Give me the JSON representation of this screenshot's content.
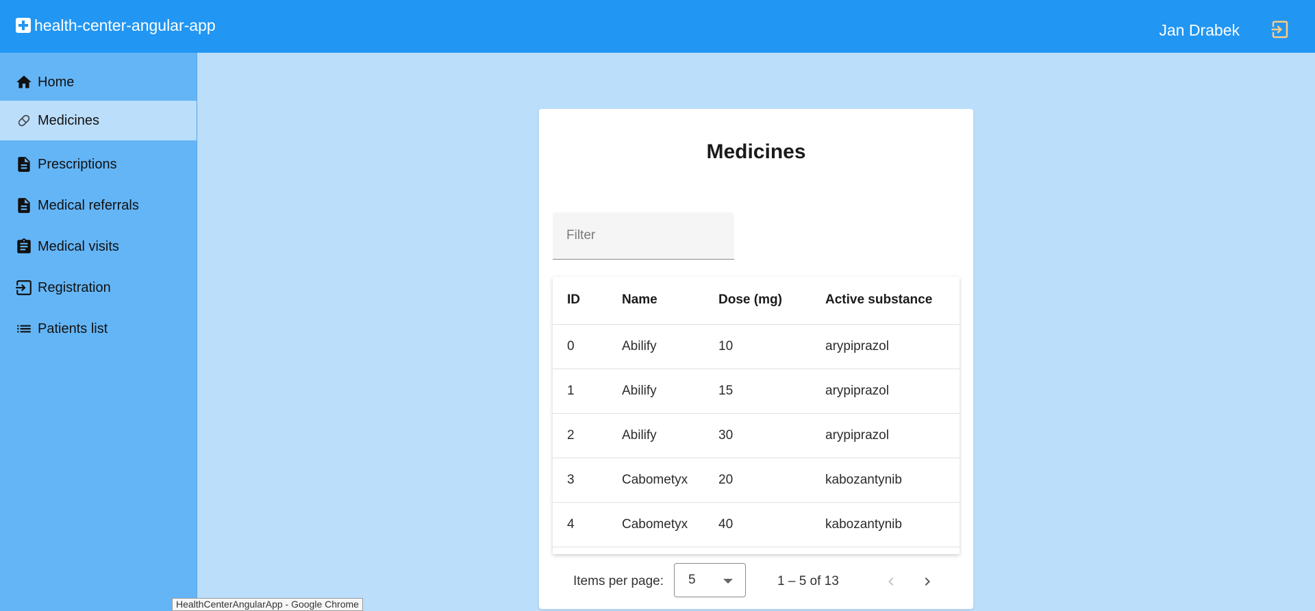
{
  "header": {
    "app_title": "health-center-angular-app",
    "user_name": "Jan Drabek",
    "brand_icon": "plus-box-icon",
    "logout_icon": "logout-icon",
    "colors": {
      "toolbar": "#2196f3",
      "logout_icon": "#ffcc80"
    }
  },
  "sidebar": {
    "items": [
      {
        "label": "Home",
        "icon": "home-icon",
        "active": false
      },
      {
        "label": "Medicines",
        "icon": "pill-icon",
        "active": true
      },
      {
        "label": "Prescriptions",
        "icon": "description-icon",
        "active": false
      },
      {
        "label": "Medical referrals",
        "icon": "description-icon",
        "active": false
      },
      {
        "label": "Medical visits",
        "icon": "assignment-icon",
        "active": false
      },
      {
        "label": "Registration",
        "icon": "login-icon",
        "active": false
      },
      {
        "label": "Patients list",
        "icon": "list-icon",
        "active": false
      }
    ]
  },
  "main": {
    "title": "Medicines",
    "filter": {
      "placeholder": "Filter",
      "value": ""
    },
    "table": {
      "columns": [
        "ID",
        "Name",
        "Dose (mg)",
        "Active substance"
      ],
      "rows": [
        [
          "0",
          "Abilify",
          "10",
          "arypiprazol"
        ],
        [
          "1",
          "Abilify",
          "15",
          "arypiprazol"
        ],
        [
          "2",
          "Abilify",
          "30",
          "arypiprazol"
        ],
        [
          "3",
          "Cabometyx",
          "20",
          "kabozantynib"
        ],
        [
          "4",
          "Cabometyx",
          "40",
          "kabozantynib"
        ]
      ]
    },
    "paginator": {
      "items_per_page_label": "Items per page:",
      "items_per_page_value": "5",
      "range_label": "1 – 5 of 13",
      "previous_disabled": true,
      "next_disabled": false
    }
  },
  "tooltip": {
    "text": "HealthCenterAngularApp - Google Chrome"
  }
}
